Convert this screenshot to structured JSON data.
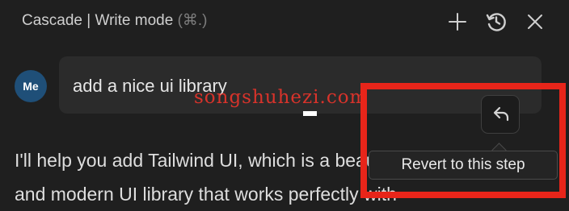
{
  "header": {
    "title": "Cascade | Write mode",
    "shortcut": "(⌘.)",
    "buttons": [
      {
        "icon": "plus-icon"
      },
      {
        "icon": "history-icon"
      },
      {
        "icon": "close-icon"
      }
    ]
  },
  "message": {
    "avatar_initials": "Me",
    "text": "add a nice ui library",
    "revert_icon": "undo-icon"
  },
  "tooltip": {
    "text": "Revert to this step"
  },
  "response": {
    "line1": "I'll help you add Tailwind UI, which is a beautiful",
    "line2": "and modern UI library that works perfectly with"
  },
  "watermark": "songshuhezi.com",
  "colors": {
    "background": "#1f1f1f",
    "bubble": "#2b2b2b",
    "avatar": "#1f4f78",
    "highlight": "#e8251a",
    "watermark": "#d8332b"
  }
}
